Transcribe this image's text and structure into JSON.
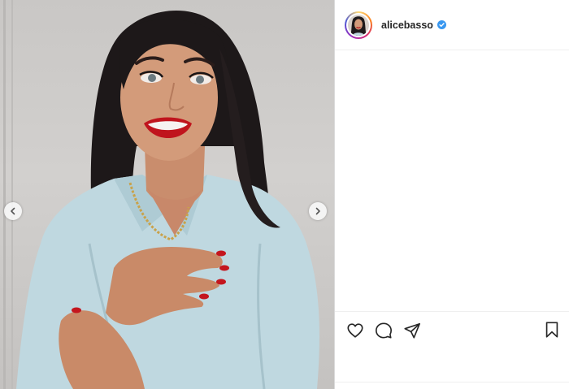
{
  "post": {
    "username": "alicebasso",
    "verified": true,
    "icons": {
      "verified": "verified-badge-icon",
      "like": "heart-icon",
      "comment": "comment-bubble-icon",
      "share": "paper-plane-icon",
      "save": "bookmark-icon",
      "prev": "chevron-left-icon",
      "next": "chevron-right-icon"
    },
    "colors": {
      "verified": "#3897f0",
      "text": "#262626",
      "border": "#dbdbdb"
    }
  }
}
